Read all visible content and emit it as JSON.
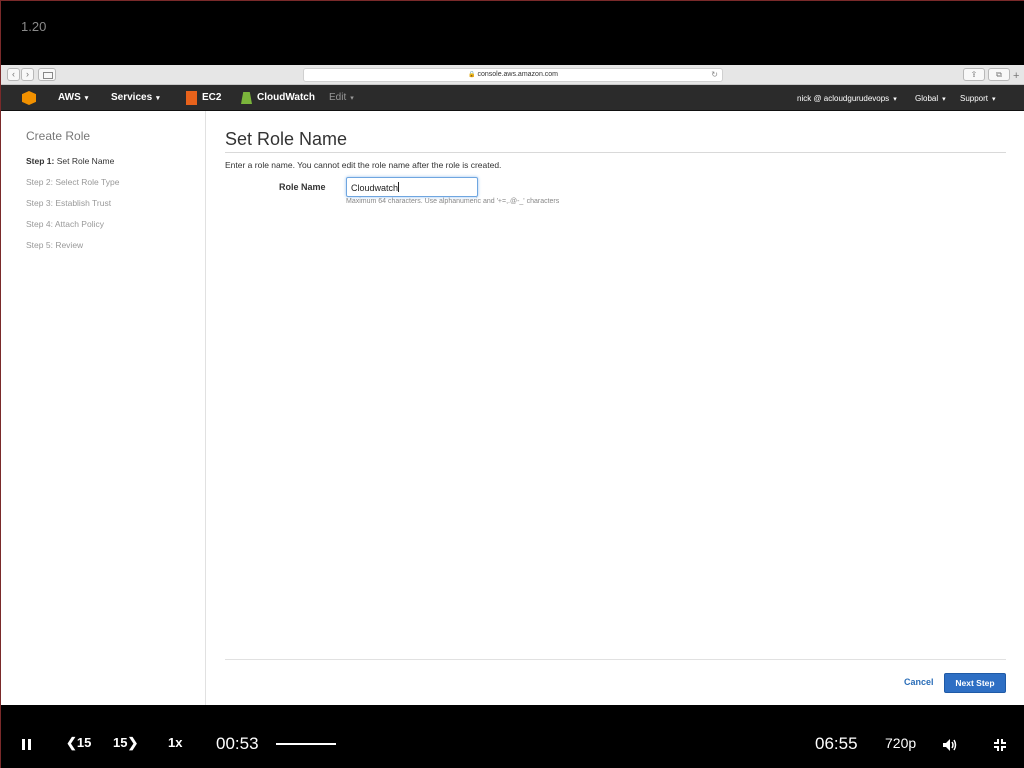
{
  "player": {
    "title": "1.20",
    "rewind_label": "15",
    "forward_label": "15",
    "speed": "1x",
    "current_time": "00:53",
    "duration": "06:55",
    "quality": "720p",
    "progress": 0.128
  },
  "browser": {
    "url": "console.aws.amazon.com",
    "back_icon": "‹",
    "forward_icon": "›",
    "reload_icon": "↻",
    "new_tab_icon": "+"
  },
  "aws_nav": {
    "aws_label": "AWS",
    "services_label": "Services",
    "ec2_label": "EC2",
    "cloudwatch_label": "CloudWatch",
    "edit_label": "Edit",
    "account_label": "nick @ acloudgurudevops",
    "region_label": "Global",
    "support_label": "Support",
    "caret": "▾"
  },
  "wizard": {
    "title": "Create Role",
    "steps": [
      {
        "prefix": "Step 1:",
        "label": "Set Role Name"
      },
      {
        "prefix": "Step 2:",
        "label": "Select Role Type"
      },
      {
        "prefix": "Step 3:",
        "label": "Establish Trust"
      },
      {
        "prefix": "Step 4:",
        "label": "Attach Policy"
      },
      {
        "prefix": "Step 5:",
        "label": "Review"
      }
    ]
  },
  "main": {
    "title": "Set Role Name",
    "instruction": "Enter a role name. You cannot edit the role name after the role is created.",
    "role_label": "Role Name",
    "role_value": "Cloudwatch",
    "hint": "Maximum 64 characters. Use alphanumeric and '+=,.@-_' characters",
    "cancel_label": "Cancel",
    "next_label": "Next Step"
  },
  "colors": {
    "aws_nav_bg": "#2b2b2b",
    "primary_button": "#2e6fc4",
    "link": "#2a6db8"
  }
}
